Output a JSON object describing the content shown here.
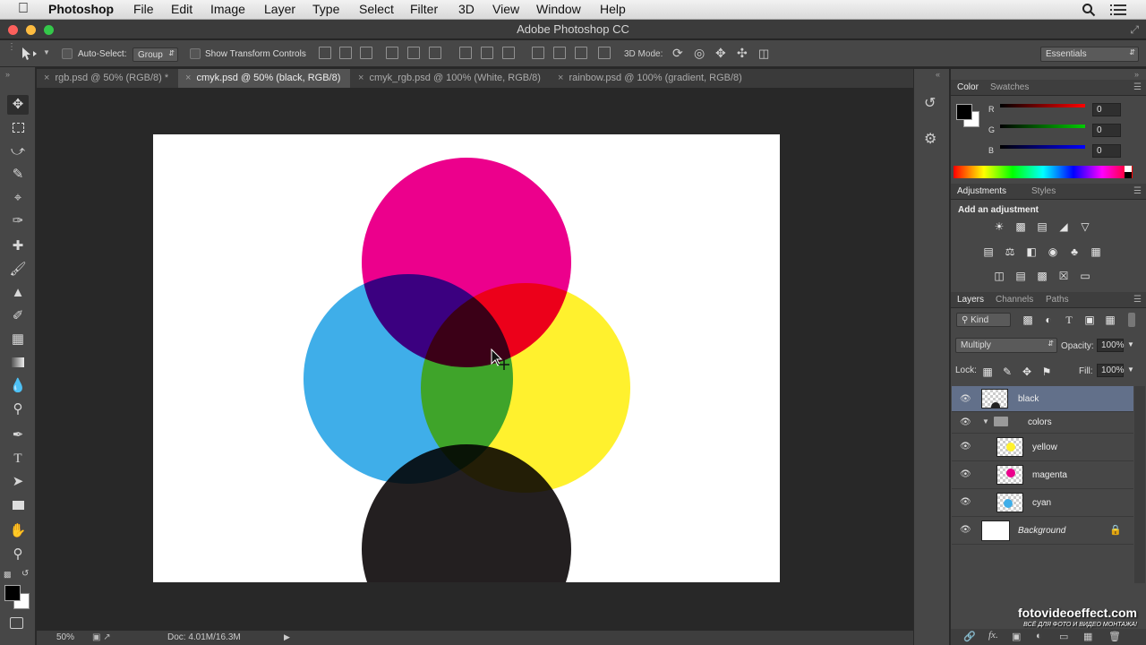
{
  "menubar": {
    "app": "Photoshop",
    "items": [
      "File",
      "Edit",
      "Image",
      "Layer",
      "Type",
      "Select",
      "Filter",
      "3D",
      "View",
      "Window",
      "Help"
    ],
    "apple_icon": "apple-icon",
    "search_icon": "search-icon",
    "list_icon": "list-icon"
  },
  "window": {
    "title": "Adobe Photoshop CC"
  },
  "options": {
    "auto_select_label": "Auto-Select:",
    "auto_select_value": "Group",
    "transform_label": "Show Transform Controls",
    "mode_3d_label": "3D Mode:",
    "workspace": "Essentials"
  },
  "tabs": [
    {
      "label": "rgb.psd @ 50% (RGB/8) *"
    },
    {
      "label": "cmyk.psd @ 50% (black, RGB/8)"
    },
    {
      "label": "cmyk_rgb.psd @ 100% (White, RGB/8)"
    },
    {
      "label": "rainbow.psd @ 100% (gradient, RGB/8)"
    }
  ],
  "status": {
    "zoom": "50%",
    "doc": "Doc: 4.01M/16.3M"
  },
  "color_panel": {
    "tabs": [
      "Color",
      "Swatches"
    ],
    "channels": [
      {
        "label": "R",
        "value": "0"
      },
      {
        "label": "G",
        "value": "0"
      },
      {
        "label": "B",
        "value": "0"
      }
    ]
  },
  "adjustments_panel": {
    "tabs": [
      "Adjustments",
      "Styles"
    ],
    "heading": "Add an adjustment"
  },
  "layers_panel": {
    "tabs": [
      "Layers",
      "Channels",
      "Paths"
    ],
    "filter": "Kind",
    "blend_mode": "Multiply",
    "opacity_label": "Opacity:",
    "opacity": "100%",
    "lock_label": "Lock:",
    "fill_label": "Fill:",
    "fill": "100%",
    "layers": [
      {
        "name": "black",
        "selected": true
      },
      {
        "name": "colors",
        "group": true
      },
      {
        "name": "yellow"
      },
      {
        "name": "magenta"
      },
      {
        "name": "cyan"
      },
      {
        "name": "Background",
        "locked": true
      }
    ]
  },
  "colors": {
    "magenta": "#ec008c",
    "cyan": "#3faee9",
    "yellow": "#fff12e",
    "black": "#231f20",
    "selection": "#62708a"
  },
  "watermark": {
    "title": "fotovideoeffect.com",
    "subtitle": "ВСЁ ДЛЯ ФОТО И ВИДЕО МОНТАЖА!"
  }
}
